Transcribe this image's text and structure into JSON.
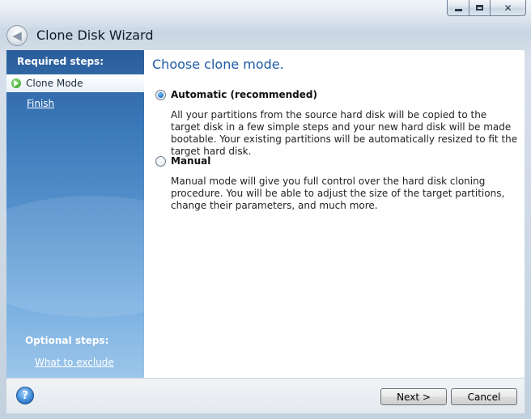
{
  "window": {
    "title": "Clone Disk Wizard",
    "controls": {
      "minimize_icon": "minimize-icon",
      "maximize_icon": "maximize-icon",
      "close_glyph": "✕"
    }
  },
  "sidebar": {
    "required_header": "Required steps:",
    "current_step": "Clone Mode",
    "steps": [
      "Finish"
    ],
    "optional_header": "Optional steps:",
    "optional_steps": [
      "What to exclude"
    ]
  },
  "main": {
    "heading": "Choose clone mode.",
    "options": [
      {
        "label": "Automatic (recommended)",
        "selected": true,
        "description": "All your partitions from the source hard disk will be copied to the target disk in a few simple steps and your new hard disk will be made bootable. Your existing partitions will be automatically resized to fit the target hard disk."
      },
      {
        "label": "Manual",
        "selected": false,
        "description": "Manual mode will give you full control over the hard disk cloning procedure. You will be able to adjust the size of the target partitions, change their parameters, and much more."
      }
    ]
  },
  "footer": {
    "help_glyph": "?",
    "next_label": "Next >",
    "cancel_label": "Cancel"
  },
  "colors": {
    "heading_blue": "#1e5aa8",
    "sidebar_top": "#2a5d9a",
    "sidebar_bottom": "#9cc6ea"
  }
}
